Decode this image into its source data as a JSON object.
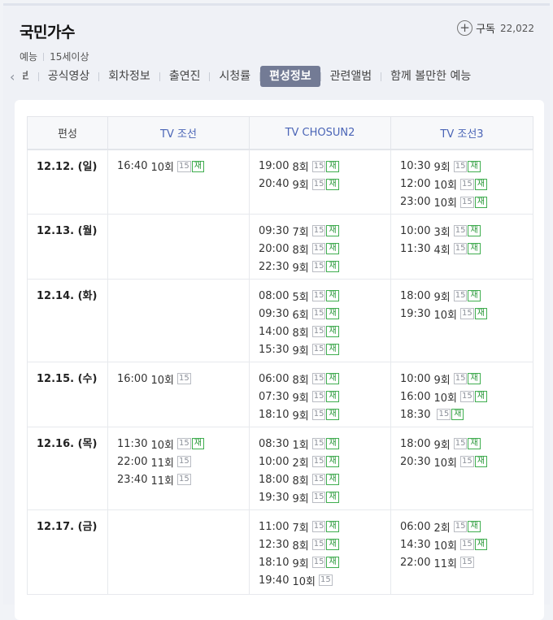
{
  "program": {
    "title": "국민가수",
    "genre": "예능",
    "age_rating": "15세이상",
    "subscribe_label": "구독",
    "subscriber_count": "22,022"
  },
  "tabs": [
    {
      "label": "정보"
    },
    {
      "label": "공식영상"
    },
    {
      "label": "회차정보"
    },
    {
      "label": "출연진"
    },
    {
      "label": "시청률"
    },
    {
      "label": "편성정보",
      "active": true
    },
    {
      "label": "관련앨범"
    },
    {
      "label": "함께 볼만한 예능"
    }
  ],
  "schedule": {
    "corner_label": "편성",
    "channels": [
      "TV 조선",
      "TV CHOSUN2",
      "TV 조선3"
    ],
    "rows": [
      {
        "date": "12.12. (일)",
        "cells": [
          [
            {
              "time": "16:40",
              "ep": "10회",
              "rating": "15",
              "rerun": "재"
            }
          ],
          [
            {
              "time": "19:00",
              "ep": "8회",
              "rating": "15",
              "rerun": "재"
            },
            {
              "time": "20:40",
              "ep": "9회",
              "rating": "15",
              "rerun": "재"
            }
          ],
          [
            {
              "time": "10:30",
              "ep": "9회",
              "rating": "15",
              "rerun": "재"
            },
            {
              "time": "12:00",
              "ep": "10회",
              "rating": "15",
              "rerun": "재"
            },
            {
              "time": "23:00",
              "ep": "10회",
              "rating": "15",
              "rerun": "재"
            }
          ]
        ]
      },
      {
        "date": "12.13. (월)",
        "cells": [
          [],
          [
            {
              "time": "09:30",
              "ep": "7회",
              "rating": "15",
              "rerun": "재"
            },
            {
              "time": "20:00",
              "ep": "8회",
              "rating": "15",
              "rerun": "재"
            },
            {
              "time": "22:30",
              "ep": "9회",
              "rating": "15",
              "rerun": "재"
            }
          ],
          [
            {
              "time": "10:00",
              "ep": "3회",
              "rating": "15",
              "rerun": "재"
            },
            {
              "time": "11:30",
              "ep": "4회",
              "rating": "15",
              "rerun": "재"
            }
          ]
        ]
      },
      {
        "date": "12.14. (화)",
        "cells": [
          [],
          [
            {
              "time": "08:00",
              "ep": "5회",
              "rating": "15",
              "rerun": "재"
            },
            {
              "time": "09:30",
              "ep": "6회",
              "rating": "15",
              "rerun": "재"
            },
            {
              "time": "14:00",
              "ep": "8회",
              "rating": "15",
              "rerun": "재"
            },
            {
              "time": "15:30",
              "ep": "9회",
              "rating": "15",
              "rerun": "재"
            }
          ],
          [
            {
              "time": "18:00",
              "ep": "9회",
              "rating": "15",
              "rerun": "재"
            },
            {
              "time": "19:30",
              "ep": "10회",
              "rating": "15",
              "rerun": "재"
            }
          ]
        ]
      },
      {
        "date": "12.15. (수)",
        "cells": [
          [
            {
              "time": "16:00",
              "ep": "10회",
              "rating": "15"
            }
          ],
          [
            {
              "time": "06:00",
              "ep": "8회",
              "rating": "15",
              "rerun": "재"
            },
            {
              "time": "07:30",
              "ep": "9회",
              "rating": "15",
              "rerun": "재"
            },
            {
              "time": "18:10",
              "ep": "9회",
              "rating": "15",
              "rerun": "재"
            }
          ],
          [
            {
              "time": "10:00",
              "ep": "9회",
              "rating": "15",
              "rerun": "재"
            },
            {
              "time": "16:00",
              "ep": "10회",
              "rating": "15",
              "rerun": "재"
            },
            {
              "time": "18:30",
              "ep": "",
              "rating": "15",
              "rerun": "재"
            }
          ]
        ]
      },
      {
        "date": "12.16. (목)",
        "cells": [
          [
            {
              "time": "11:30",
              "ep": "10회",
              "rating": "15",
              "rerun": "재"
            },
            {
              "time": "22:00",
              "ep": "11회",
              "rating": "15"
            },
            {
              "time": "23:40",
              "ep": "11회",
              "rating": "15"
            }
          ],
          [
            {
              "time": "08:30",
              "ep": "1회",
              "rating": "15",
              "rerun": "재"
            },
            {
              "time": "10:00",
              "ep": "2회",
              "rating": "15",
              "rerun": "재"
            },
            {
              "time": "18:00",
              "ep": "8회",
              "rating": "15",
              "rerun": "재"
            },
            {
              "time": "19:30",
              "ep": "9회",
              "rating": "15",
              "rerun": "재"
            }
          ],
          [
            {
              "time": "18:00",
              "ep": "9회",
              "rating": "15",
              "rerun": "재"
            },
            {
              "time": "20:30",
              "ep": "10회",
              "rating": "15",
              "rerun": "재"
            }
          ]
        ]
      },
      {
        "date": "12.17. (금)",
        "cells": [
          [],
          [
            {
              "time": "11:00",
              "ep": "7회",
              "rating": "15",
              "rerun": "재"
            },
            {
              "time": "12:30",
              "ep": "8회",
              "rating": "15",
              "rerun": "재"
            },
            {
              "time": "18:10",
              "ep": "9회",
              "rating": "15",
              "rerun": "재"
            },
            {
              "time": "19:40",
              "ep": "10회",
              "rating": "15"
            }
          ],
          [
            {
              "time": "06:00",
              "ep": "2회",
              "rating": "15",
              "rerun": "재"
            },
            {
              "time": "14:30",
              "ep": "10회",
              "rating": "15",
              "rerun": "재"
            },
            {
              "time": "22:00",
              "ep": "11회",
              "rating": "15"
            }
          ]
        ]
      }
    ]
  }
}
